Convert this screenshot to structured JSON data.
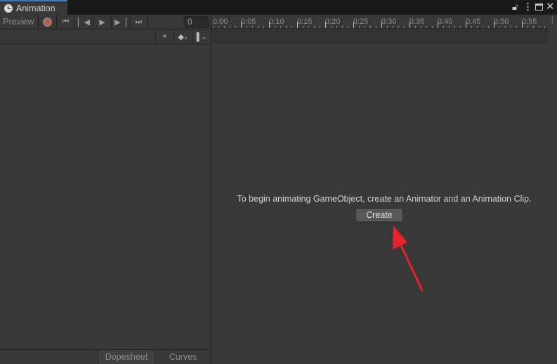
{
  "window": {
    "tab_title": "Animation",
    "tab_icon": "clock-icon",
    "accent": "#3a79bb"
  },
  "toolbar": {
    "preview_label": "Preview",
    "frame_value": "0",
    "record_color": "#c8553d"
  },
  "timeline": {
    "labels": [
      "0:00",
      "0:05",
      "0:10",
      "0:15",
      "0:20",
      "0:25",
      "0:30",
      "0:35",
      "0:40",
      "0:45",
      "0:50",
      "0:55"
    ]
  },
  "main": {
    "message": "To begin animating GameObject, create an Animator and an Animation Clip.",
    "create_label": "Create",
    "arrow_color": "#e8222a"
  },
  "bottom": {
    "dopesheet_label": "Dopesheet",
    "curves_label": "Curves"
  }
}
